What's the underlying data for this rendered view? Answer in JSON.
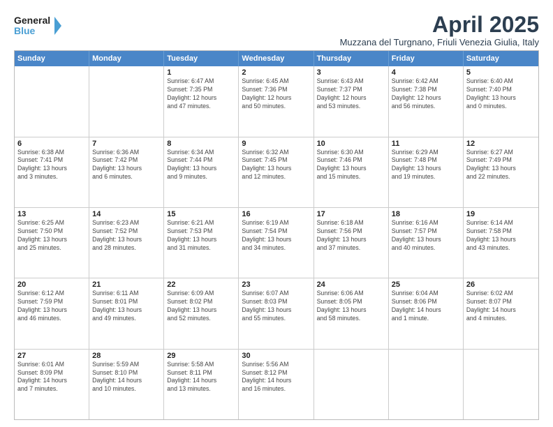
{
  "logo": {
    "line1": "General",
    "line2": "Blue",
    "icon": "▶"
  },
  "title": "April 2025",
  "subtitle": "Muzzana del Turgnano, Friuli Venezia Giulia, Italy",
  "header_days": [
    "Sunday",
    "Monday",
    "Tuesday",
    "Wednesday",
    "Thursday",
    "Friday",
    "Saturday"
  ],
  "weeks": [
    [
      {
        "day": "",
        "info": ""
      },
      {
        "day": "",
        "info": ""
      },
      {
        "day": "1",
        "info": "Sunrise: 6:47 AM\nSunset: 7:35 PM\nDaylight: 12 hours\nand 47 minutes."
      },
      {
        "day": "2",
        "info": "Sunrise: 6:45 AM\nSunset: 7:36 PM\nDaylight: 12 hours\nand 50 minutes."
      },
      {
        "day": "3",
        "info": "Sunrise: 6:43 AM\nSunset: 7:37 PM\nDaylight: 12 hours\nand 53 minutes."
      },
      {
        "day": "4",
        "info": "Sunrise: 6:42 AM\nSunset: 7:38 PM\nDaylight: 12 hours\nand 56 minutes."
      },
      {
        "day": "5",
        "info": "Sunrise: 6:40 AM\nSunset: 7:40 PM\nDaylight: 13 hours\nand 0 minutes."
      }
    ],
    [
      {
        "day": "6",
        "info": "Sunrise: 6:38 AM\nSunset: 7:41 PM\nDaylight: 13 hours\nand 3 minutes."
      },
      {
        "day": "7",
        "info": "Sunrise: 6:36 AM\nSunset: 7:42 PM\nDaylight: 13 hours\nand 6 minutes."
      },
      {
        "day": "8",
        "info": "Sunrise: 6:34 AM\nSunset: 7:44 PM\nDaylight: 13 hours\nand 9 minutes."
      },
      {
        "day": "9",
        "info": "Sunrise: 6:32 AM\nSunset: 7:45 PM\nDaylight: 13 hours\nand 12 minutes."
      },
      {
        "day": "10",
        "info": "Sunrise: 6:30 AM\nSunset: 7:46 PM\nDaylight: 13 hours\nand 15 minutes."
      },
      {
        "day": "11",
        "info": "Sunrise: 6:29 AM\nSunset: 7:48 PM\nDaylight: 13 hours\nand 19 minutes."
      },
      {
        "day": "12",
        "info": "Sunrise: 6:27 AM\nSunset: 7:49 PM\nDaylight: 13 hours\nand 22 minutes."
      }
    ],
    [
      {
        "day": "13",
        "info": "Sunrise: 6:25 AM\nSunset: 7:50 PM\nDaylight: 13 hours\nand 25 minutes."
      },
      {
        "day": "14",
        "info": "Sunrise: 6:23 AM\nSunset: 7:52 PM\nDaylight: 13 hours\nand 28 minutes."
      },
      {
        "day": "15",
        "info": "Sunrise: 6:21 AM\nSunset: 7:53 PM\nDaylight: 13 hours\nand 31 minutes."
      },
      {
        "day": "16",
        "info": "Sunrise: 6:19 AM\nSunset: 7:54 PM\nDaylight: 13 hours\nand 34 minutes."
      },
      {
        "day": "17",
        "info": "Sunrise: 6:18 AM\nSunset: 7:56 PM\nDaylight: 13 hours\nand 37 minutes."
      },
      {
        "day": "18",
        "info": "Sunrise: 6:16 AM\nSunset: 7:57 PM\nDaylight: 13 hours\nand 40 minutes."
      },
      {
        "day": "19",
        "info": "Sunrise: 6:14 AM\nSunset: 7:58 PM\nDaylight: 13 hours\nand 43 minutes."
      }
    ],
    [
      {
        "day": "20",
        "info": "Sunrise: 6:12 AM\nSunset: 7:59 PM\nDaylight: 13 hours\nand 46 minutes."
      },
      {
        "day": "21",
        "info": "Sunrise: 6:11 AM\nSunset: 8:01 PM\nDaylight: 13 hours\nand 49 minutes."
      },
      {
        "day": "22",
        "info": "Sunrise: 6:09 AM\nSunset: 8:02 PM\nDaylight: 13 hours\nand 52 minutes."
      },
      {
        "day": "23",
        "info": "Sunrise: 6:07 AM\nSunset: 8:03 PM\nDaylight: 13 hours\nand 55 minutes."
      },
      {
        "day": "24",
        "info": "Sunrise: 6:06 AM\nSunset: 8:05 PM\nDaylight: 13 hours\nand 58 minutes."
      },
      {
        "day": "25",
        "info": "Sunrise: 6:04 AM\nSunset: 8:06 PM\nDaylight: 14 hours\nand 1 minute."
      },
      {
        "day": "26",
        "info": "Sunrise: 6:02 AM\nSunset: 8:07 PM\nDaylight: 14 hours\nand 4 minutes."
      }
    ],
    [
      {
        "day": "27",
        "info": "Sunrise: 6:01 AM\nSunset: 8:09 PM\nDaylight: 14 hours\nand 7 minutes."
      },
      {
        "day": "28",
        "info": "Sunrise: 5:59 AM\nSunset: 8:10 PM\nDaylight: 14 hours\nand 10 minutes."
      },
      {
        "day": "29",
        "info": "Sunrise: 5:58 AM\nSunset: 8:11 PM\nDaylight: 14 hours\nand 13 minutes."
      },
      {
        "day": "30",
        "info": "Sunrise: 5:56 AM\nSunset: 8:12 PM\nDaylight: 14 hours\nand 16 minutes."
      },
      {
        "day": "",
        "info": ""
      },
      {
        "day": "",
        "info": ""
      },
      {
        "day": "",
        "info": ""
      }
    ]
  ]
}
